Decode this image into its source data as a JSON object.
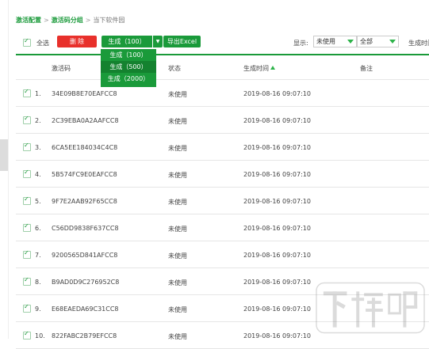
{
  "breadcrumb": {
    "item1": "激活配置",
    "sep1": ">",
    "item2": "激活码分组",
    "sep2": ">",
    "current": "当下软件园"
  },
  "toolbar": {
    "select_all": "全选",
    "delete": "删 除",
    "generate": "生成（100）",
    "export": "导出Excel",
    "show_label": "显示:",
    "status_filter": "未使用",
    "range_filter": "全部",
    "gentime_label": "生成时间"
  },
  "dropdown": {
    "options": [
      "生成（100）",
      "生成（500）",
      "生成（2000）"
    ]
  },
  "table": {
    "headers": {
      "code": "激活码",
      "status": "状态",
      "time": "生成时间",
      "note": "备注"
    },
    "rows": [
      {
        "idx": "1.",
        "code": "34E09B8E70EAFCC8",
        "status": "未使用",
        "time": "2019-08-16 09:07:10"
      },
      {
        "idx": "2.",
        "code": "2C39EBA0A2AAFCC8",
        "status": "未使用",
        "time": "2019-08-16 09:07:10"
      },
      {
        "idx": "3.",
        "code": "6CA5EE184034C4C8",
        "status": "未使用",
        "time": "2019-08-16 09:07:10"
      },
      {
        "idx": "4.",
        "code": "5B574FC9E0EAFCC8",
        "status": "未使用",
        "time": "2019-08-16 09:07:10"
      },
      {
        "idx": "5.",
        "code": "9F7E2AAB92F65CC8",
        "status": "未使用",
        "time": "2019-08-16 09:07:10"
      },
      {
        "idx": "6.",
        "code": "C56DD9838F637CC8",
        "status": "未使用",
        "time": "2019-08-16 09:07:10"
      },
      {
        "idx": "7.",
        "code": "9200565D841AFCC8",
        "status": "未使用",
        "time": "2019-08-16 09:07:10"
      },
      {
        "idx": "8.",
        "code": "B9AD0D9C276952C8",
        "status": "未使用",
        "time": "2019-08-16 09:07:10"
      },
      {
        "idx": "9.",
        "code": "E68EAEDA69C31CC8",
        "status": "未使用",
        "time": "2019-08-16 09:07:10"
      },
      {
        "idx": "10.",
        "code": "822FABC2B79EFCC8",
        "status": "未使用",
        "time": "2019-08-16 09:07:10"
      }
    ]
  },
  "watermark": {
    "text": "下载吧"
  },
  "colors": {
    "accent": "#1a9a3a",
    "danger": "#e8302b",
    "border": "#e6e6e6"
  }
}
